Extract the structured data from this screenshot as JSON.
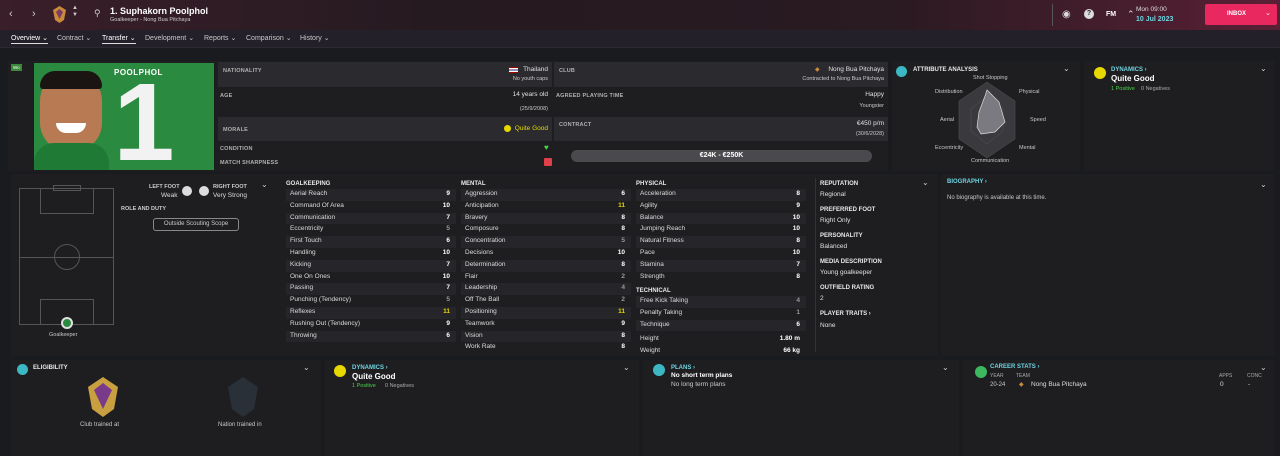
{
  "header": {
    "name": "1. Suphakorn Poolphol",
    "subtitle": "Goalkeeper - Nong Bua Pitchaya",
    "fm": "FM",
    "time": "Mon 09:00",
    "date": "10 Jul 2023",
    "inbox": "INBOX"
  },
  "tabs": [
    "Overview",
    "Contract",
    "Transfer",
    "Development",
    "Reports",
    "Comparison",
    "History"
  ],
  "profile": {
    "shirt_name": "POOLPHOL",
    "shirt_number": "1",
    "badge": "Wo"
  },
  "info": {
    "nationality_label": "NATIONALITY",
    "nationality": "Thailand",
    "youth_caps": "No youth caps",
    "club_label": "CLUB",
    "club": "Nong Bua Pitchaya",
    "club_contract": "Contracted to Nong Bua Pitchaya",
    "age_label": "AGE",
    "age": "14 years old",
    "dob": "(25/9/2008)",
    "apt_label": "AGREED PLAYING TIME",
    "apt": "Happy",
    "apt_sub": "Youngster",
    "morale_label": "MORALE",
    "morale": "Quite Good",
    "contract_label": "CONTRACT",
    "wage": "€450 p/m",
    "contract_end": "(30/6/2028)",
    "condition_label": "CONDITION",
    "sharpness_label": "MATCH SHARPNESS",
    "value": "€24K - €250K"
  },
  "attr_analysis": {
    "title": "ATTRIBUTE ANALYSIS",
    "labels": [
      "Shot Stopping",
      "Physical",
      "Speed",
      "Mental",
      "Communication",
      "Eccentricity",
      "Aerial",
      "Distribution"
    ]
  },
  "dynamics": {
    "title": "DYNAMICS",
    "value": "Quite Good",
    "pos": "1 Positive",
    "neg": "0 Negatives"
  },
  "pitch": {
    "position": "Goalkeeper"
  },
  "feet": {
    "left_label": "LEFT FOOT",
    "left": "Weak",
    "right_label": "RIGHT FOOT",
    "right": "Very Strong",
    "role_label": "ROLE AND DUTY",
    "scouting": "Outside Scouting Scope"
  },
  "goalkeeping": {
    "title": "GOALKEEPING",
    "rows": [
      [
        "Aerial Reach",
        "9"
      ],
      [
        "Command Of Area",
        "10"
      ],
      [
        "Communication",
        "7"
      ],
      [
        "Eccentricity",
        "5"
      ],
      [
        "First Touch",
        "6"
      ],
      [
        "Handling",
        "10"
      ],
      [
        "Kicking",
        "7"
      ],
      [
        "One On Ones",
        "10"
      ],
      [
        "Passing",
        "7"
      ],
      [
        "Punching (Tendency)",
        "5"
      ],
      [
        "Reflexes",
        "11"
      ],
      [
        "Rushing Out (Tendency)",
        "9"
      ],
      [
        "Throwing",
        "6"
      ]
    ]
  },
  "mental": {
    "title": "MENTAL",
    "rows": [
      [
        "Aggression",
        "6"
      ],
      [
        "Anticipation",
        "11"
      ],
      [
        "Bravery",
        "8"
      ],
      [
        "Composure",
        "8"
      ],
      [
        "Concentration",
        "5"
      ],
      [
        "Decisions",
        "10"
      ],
      [
        "Determination",
        "8"
      ],
      [
        "Flair",
        "2"
      ],
      [
        "Leadership",
        "4"
      ],
      [
        "Off The Ball",
        "2"
      ],
      [
        "Positioning",
        "11"
      ],
      [
        "Teamwork",
        "9"
      ],
      [
        "Vision",
        "8"
      ],
      [
        "Work Rate",
        "8"
      ]
    ]
  },
  "physical": {
    "title": "PHYSICAL",
    "rows": [
      [
        "Acceleration",
        "8"
      ],
      [
        "Agility",
        "9"
      ],
      [
        "Balance",
        "10"
      ],
      [
        "Jumping Reach",
        "10"
      ],
      [
        "Natural Fitness",
        "8"
      ],
      [
        "Pace",
        "10"
      ],
      [
        "Stamina",
        "7"
      ],
      [
        "Strength",
        "8"
      ]
    ]
  },
  "technical": {
    "title": "TECHNICAL",
    "rows": [
      [
        "Free Kick Taking",
        "4"
      ],
      [
        "Penalty Taking",
        "1"
      ],
      [
        "Technique",
        "6"
      ]
    ]
  },
  "hw": {
    "height_label": "Height",
    "height": "1.80 m",
    "weight_label": "Weight",
    "weight": "66 kg"
  },
  "side": {
    "reputation_label": "REPUTATION",
    "reputation": "Regional",
    "pref_foot_label": "PREFERRED FOOT",
    "pref_foot": "Right Only",
    "personality_label": "PERSONALITY",
    "personality": "Balanced",
    "media_label": "MEDIA DESCRIPTION",
    "media": "Young goalkeeper",
    "outfield_label": "OUTFIELD RATING",
    "outfield": "2",
    "traits_label": "PLAYER TRAITS",
    "traits": "None"
  },
  "biography": {
    "title": "BIOGRAPHY",
    "text": "No biography is available at this time."
  },
  "eligibility": {
    "title": "ELIGIBILITY",
    "club": "Club trained at",
    "nation": "Nation trained in"
  },
  "plans": {
    "title": "PLANS",
    "short": "No short term plans",
    "long": "No long term plans"
  },
  "career": {
    "title": "CAREER STATS",
    "year_label": "YEAR",
    "team_label": "TEAM",
    "apps_label": "APPS",
    "conc_label": "CONC",
    "year": "20-24",
    "team": "Nong Bua Pitchaya",
    "apps": "0",
    "conc": "-"
  }
}
